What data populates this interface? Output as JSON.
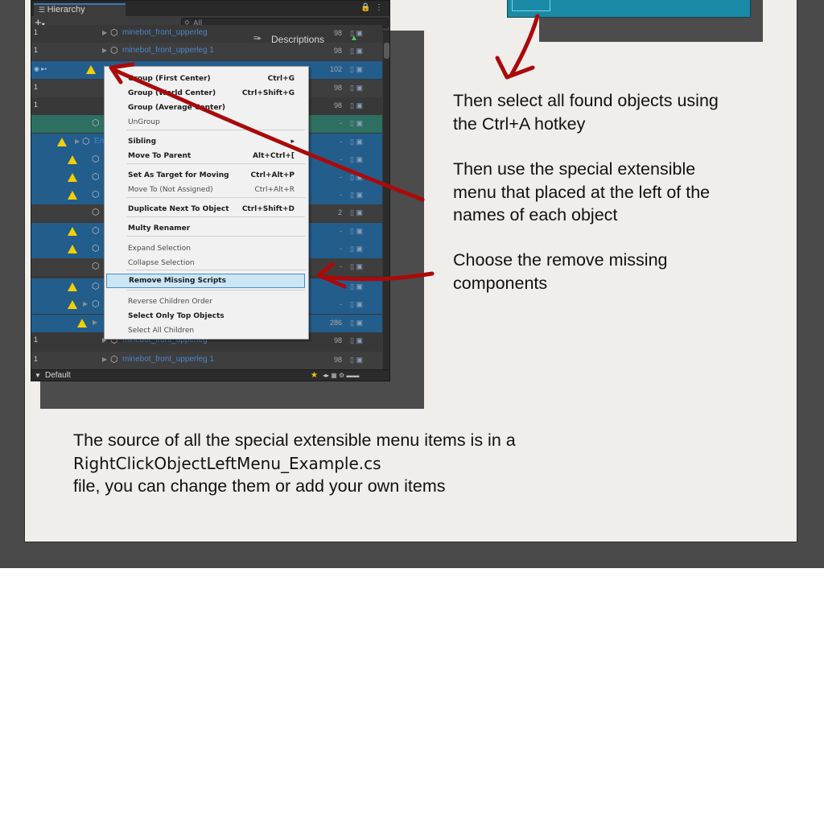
{
  "hierarchy": {
    "tab_label": "Hierarchy",
    "search_placeholder": "All",
    "descriptions_label": "Descriptions",
    "footer_label": "Default",
    "rows": [
      {
        "num": "1",
        "name": "minebot_front_upperleg",
        "count": "98"
      },
      {
        "num": "1",
        "name": "minebot_front_upperleg 1",
        "count": "98"
      },
      {
        "num": "",
        "name": "",
        "count": "102"
      },
      {
        "num": "1",
        "name": "",
        "count": "98"
      },
      {
        "num": "1",
        "name": "",
        "count": "98"
      },
      {
        "num": "",
        "name": "",
        "count": "-"
      },
      {
        "num": "",
        "name": "En",
        "count": "-"
      },
      {
        "num": "",
        "name": "",
        "count": "-"
      },
      {
        "num": "",
        "name": "",
        "count": "-"
      },
      {
        "num": "",
        "name": "",
        "count": "-"
      },
      {
        "num": "",
        "name": "",
        "count": "2"
      },
      {
        "num": "",
        "name": "",
        "count": "-"
      },
      {
        "num": "",
        "name": "",
        "count": "-"
      },
      {
        "num": "",
        "name": "",
        "count": "-"
      },
      {
        "num": "",
        "name": "",
        "count": "-"
      },
      {
        "num": "",
        "name": "",
        "count": "-"
      },
      {
        "num": "",
        "name": "",
        "count": "286"
      },
      {
        "num": "1",
        "name": "minebot_front_upperleg",
        "count": "98"
      },
      {
        "num": "1",
        "name": "minebot_front_upperleg 1",
        "count": "98"
      }
    ]
  },
  "menu": {
    "items": [
      {
        "label": "Group (First Center)",
        "shortcut": "Ctrl+G"
      },
      {
        "label": "Group (World Center)",
        "shortcut": "Ctrl+Shift+G"
      },
      {
        "label": "Group (Average Center)",
        "shortcut": ""
      },
      {
        "label": "UnGroup",
        "shortcut": ""
      },
      {
        "label": "Sibling",
        "shortcut": "▸"
      },
      {
        "label": "Move To Parent",
        "shortcut": "Alt+Ctrl+["
      },
      {
        "label": "Set As Target for Moving",
        "shortcut": "Ctrl+Alt+P"
      },
      {
        "label": "Move To (Not Assigned)",
        "shortcut": "Ctrl+Alt+R"
      },
      {
        "label": "Duplicate Next To Object",
        "shortcut": "Ctrl+Shift+D"
      },
      {
        "label": "Multy Renamer",
        "shortcut": ""
      },
      {
        "label": "Expand Selection",
        "shortcut": ""
      },
      {
        "label": "Collapse Selection",
        "shortcut": ""
      },
      {
        "label": "Remove Missing Scripts",
        "shortcut": ""
      },
      {
        "label": "Reverse Children Order",
        "shortcut": ""
      },
      {
        "label": "Select Only Top Objects",
        "shortcut": ""
      },
      {
        "label": "Select All Children",
        "shortcut": ""
      }
    ]
  },
  "annotations": {
    "select_all": [
      "Then select all found objects using",
      "the Ctrl+A hotkey"
    ],
    "special_menu": [
      "Then use the special extensible",
      "menu that placed at the left of the",
      "names of each object"
    ],
    "remove_missing": [
      "Choose the remove missing",
      "components"
    ],
    "source_line1": "The source of all the special extensible menu items is in a",
    "source_file": "RightClickObjectLeftMenu_Example.cs",
    "source_line3": "file, you can change them or add your own items"
  },
  "colors": {
    "arrow": "#aa0a0a",
    "selection": "#235d8c",
    "highlight": "#cce6f6",
    "warning": "#f2d000"
  }
}
